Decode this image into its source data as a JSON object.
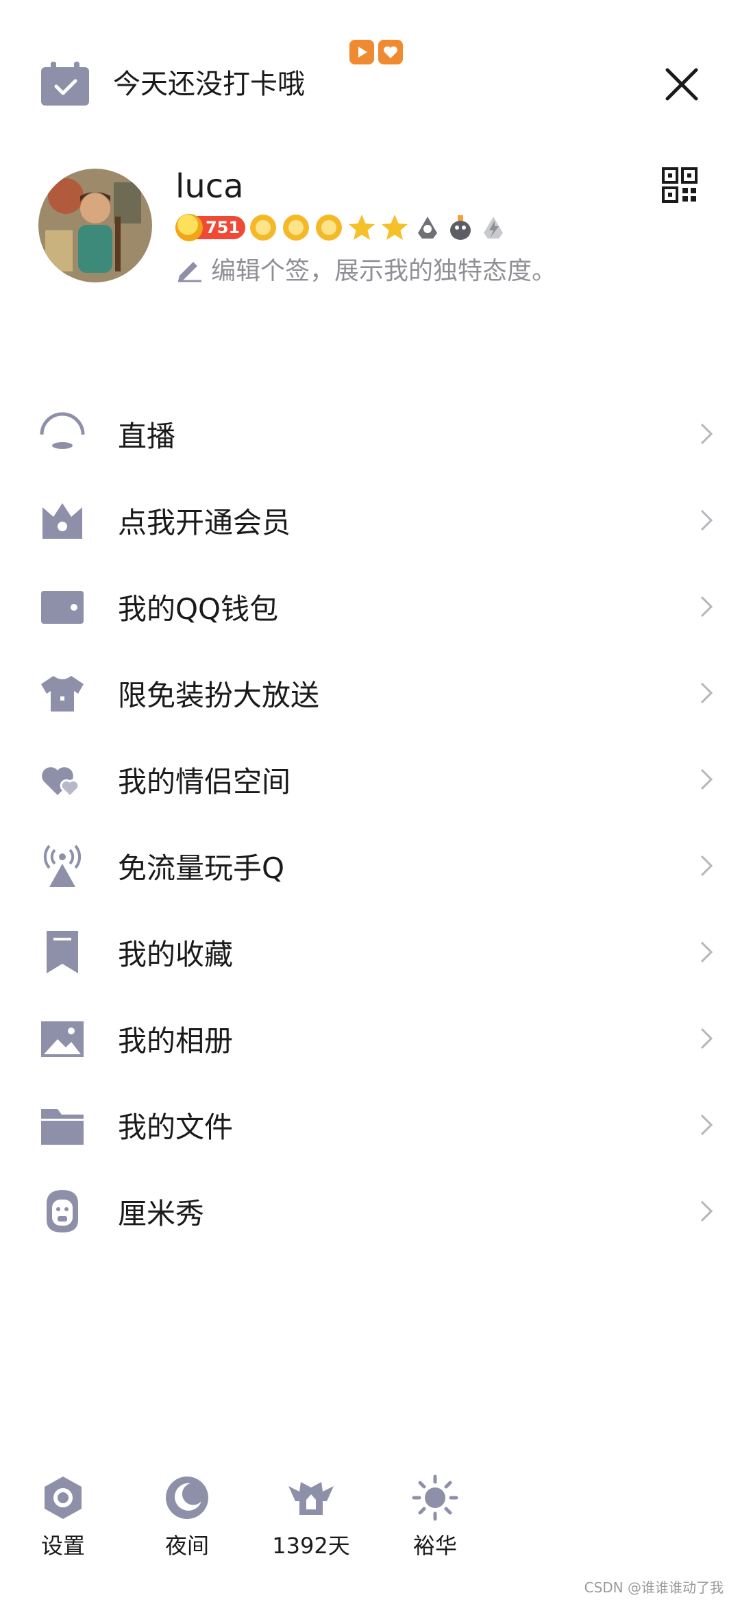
{
  "header": {
    "checkin_text": "今天还没打卡哦",
    "close_icon": "close-icon",
    "checkin_icon": "calendar-check-icon"
  },
  "profile": {
    "username": "luca",
    "level": "751",
    "signature": "编辑个签，展示我的独特态度。",
    "edit_icon": "pencil-icon",
    "qr_icon": "qr-code-icon"
  },
  "menu": {
    "items": [
      {
        "label": "直播",
        "icon": "live-icon"
      },
      {
        "label": "点我开通会员",
        "icon": "crown-icon"
      },
      {
        "label": "我的QQ钱包",
        "icon": "wallet-icon"
      },
      {
        "label": "限免装扮大放送",
        "icon": "tshirt-icon"
      },
      {
        "label": "我的情侣空间",
        "icon": "hearts-icon"
      },
      {
        "label": "免流量玩手Q",
        "icon": "signal-tower-icon"
      },
      {
        "label": "我的收藏",
        "icon": "bookmark-icon"
      },
      {
        "label": "我的相册",
        "icon": "image-icon"
      },
      {
        "label": "我的文件",
        "icon": "folder-icon"
      },
      {
        "label": "厘米秀",
        "icon": "cmshow-icon"
      }
    ]
  },
  "bottom": {
    "items": [
      {
        "label": "设置",
        "icon": "settings-icon"
      },
      {
        "label": "夜间",
        "icon": "moon-icon"
      },
      {
        "label": "1392天",
        "icon": "qq-days-icon"
      },
      {
        "label": "裕华",
        "icon": "weather-sun-icon"
      }
    ]
  },
  "watermark": "CSDN @谁谁谁动了我",
  "colors": {
    "icon": "#8e90a9",
    "level_badge": "#f04a36",
    "promo": "#f08a30"
  }
}
